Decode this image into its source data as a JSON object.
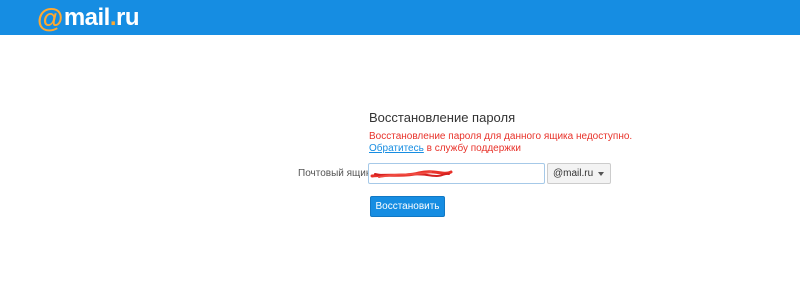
{
  "header": {
    "logo_at": "@",
    "logo_text": "mail",
    "logo_dot": ".",
    "logo_tld": "ru",
    "background_color": "#168de2",
    "accent_color": "#ffa930"
  },
  "form": {
    "title": "Восстановление пароля",
    "error_line1": "Восстановление пароля для данного ящика недоступно.",
    "support_link": "Обратитесь",
    "error_line2_rest": " в службу поддержки",
    "field_label": "Почтовый ящик",
    "login_value_redacted": true,
    "domain_value": "@mail.ru",
    "submit_label": "Восстановить",
    "error_color": "#e8322a",
    "button_color": "#168de2"
  }
}
